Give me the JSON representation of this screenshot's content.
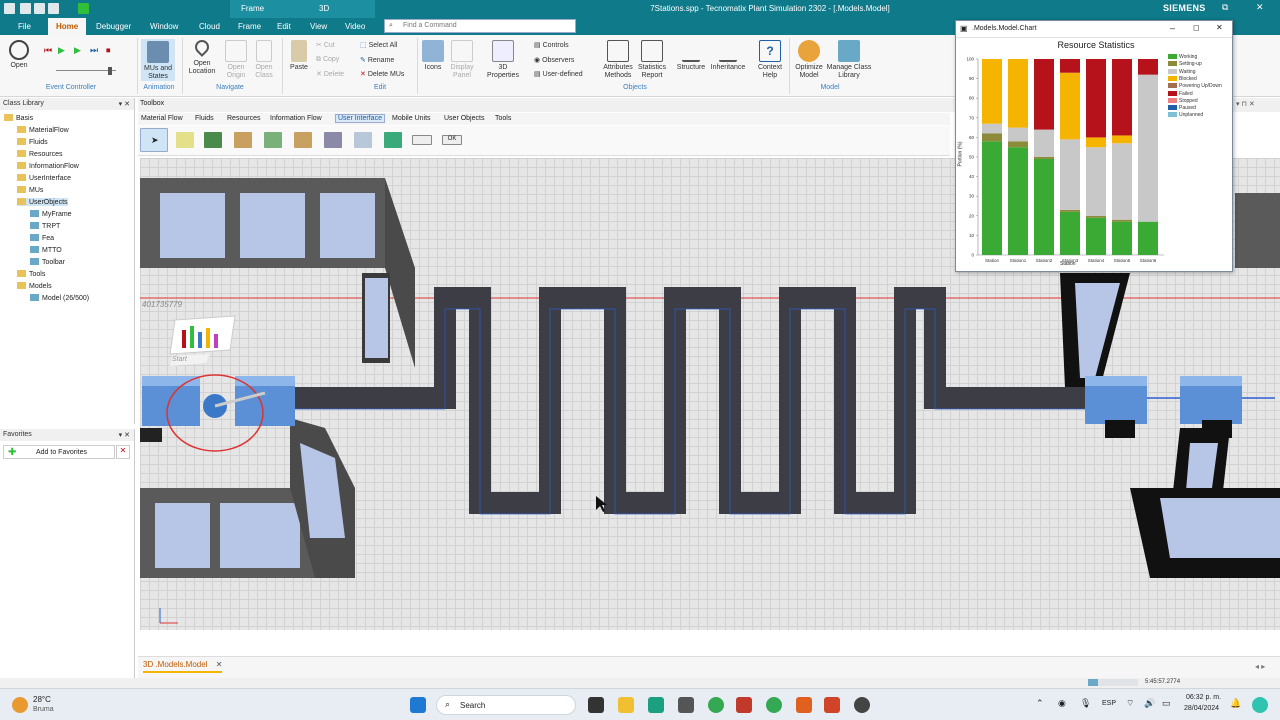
{
  "app": {
    "window_title": "7Stations.spp - Tecnomatix Plant Simulation 2302 - [.Models.Model]",
    "brand": "SIEMENS",
    "contextual_tabs": {
      "frame": "Frame",
      "threed": "3D"
    }
  },
  "menu": [
    "File",
    "Home",
    "Debugger",
    "Window",
    "Cloud",
    "Frame",
    "Edit",
    "View",
    "Video"
  ],
  "command_search": {
    "placeholder": "Find a Command"
  },
  "ribbon": {
    "event_controller": {
      "open": "Open",
      "group": "Event Controller"
    },
    "animation": {
      "mus_and_states": "MUs and States",
      "group": "Animation"
    },
    "navigate": {
      "open_location": "Open Location",
      "open_origin": "Open Origin",
      "open_class": "Open Class",
      "group": "Navigate"
    },
    "edit": {
      "paste": "Paste",
      "cut": "Cut",
      "copy": "Copy",
      "delete": "Delete",
      "select_all": "Select All",
      "rename": "Rename",
      "delete_mus": "Delete MUs",
      "group": "Edit"
    },
    "objects": {
      "icons": "Icons",
      "display_panel": "Display Panel",
      "properties_3d": "3D Properties",
      "controls": "Controls",
      "observers": "Observers",
      "user_defined": "User-defined",
      "attributes_methods": "Attributes Methods",
      "statistics_report": "Statistics Report",
      "structure": "Structure",
      "inheritance": "Inheritance",
      "context_help": "Context Help",
      "group": "Objects"
    },
    "model": {
      "optimize_model": "Optimize Model",
      "manage_class_library": "Manage Class Library",
      "group": "Model"
    }
  },
  "class_library": {
    "title": "Class Library",
    "items": [
      {
        "label": "Basis",
        "level": 0
      },
      {
        "label": "MaterialFlow",
        "level": 1
      },
      {
        "label": "Fluids",
        "level": 1
      },
      {
        "label": "Resources",
        "level": 1
      },
      {
        "label": "InformationFlow",
        "level": 1
      },
      {
        "label": "UserInterface",
        "level": 1
      },
      {
        "label": "MUs",
        "level": 1
      },
      {
        "label": "UserObjects",
        "level": 1
      },
      {
        "label": "MyFrame",
        "level": 2
      },
      {
        "label": "TRPT",
        "level": 2
      },
      {
        "label": "Fea",
        "level": 2
      },
      {
        "label": "MTTO",
        "level": 2
      },
      {
        "label": "Toolbar",
        "level": 2
      },
      {
        "label": "Tools",
        "level": 1
      },
      {
        "label": "Models",
        "level": 1
      },
      {
        "label": "Model (26/500)",
        "level": 2
      }
    ]
  },
  "favorites": {
    "title": "Favorites",
    "add_label": "Add to Favorites"
  },
  "toolbox": {
    "title": "Toolbox",
    "tabs": [
      "Material Flow",
      "Fluids",
      "Resources",
      "Information Flow",
      "User Interface",
      "Mobile Units",
      "User Objects",
      "Tools"
    ],
    "active_tab": "User Interface",
    "ok_label": "OK"
  },
  "scene": {
    "id_label": "401735779",
    "start_label": "Start"
  },
  "document_tab": {
    "label": "3D .Models.Model"
  },
  "status": {
    "time": "5:45:57.2774"
  },
  "chart_window": {
    "title": ".Models.Model.Chart"
  },
  "chart_data": {
    "type": "bar",
    "stacked": true,
    "title": "Resource Statistics",
    "ylabel": "Portion (%)",
    "xlabel": "Station",
    "ylim": [
      0,
      100
    ],
    "yticks": [
      0,
      10,
      20,
      30,
      40,
      50,
      60,
      70,
      80,
      90,
      100
    ],
    "grid": false,
    "legend_position": "right",
    "categories": [
      "Station",
      "Station1",
      "Station2",
      "Station3",
      "Station4",
      "Station5",
      "Station6"
    ],
    "series": [
      {
        "name": "Working",
        "color": "#3aaa35",
        "values": [
          58,
          55,
          49,
          22,
          19,
          17,
          17
        ]
      },
      {
        "name": "Setting-up",
        "color": "#8b8b3a",
        "values": [
          4,
          3,
          1,
          1,
          1,
          1,
          0
        ]
      },
      {
        "name": "Waiting",
        "color": "#c8c8c8",
        "values": [
          5,
          7,
          14,
          36,
          35,
          39,
          75
        ]
      },
      {
        "name": "Blocked",
        "color": "#f5b400",
        "values": [
          33,
          35,
          0,
          34,
          5,
          4,
          0
        ]
      },
      {
        "name": "Powering Up/Down",
        "color": "#a07050",
        "values": [
          0,
          0,
          0,
          0,
          0,
          0,
          0
        ]
      },
      {
        "name": "Failed",
        "color": "#b5121b",
        "values": [
          0,
          0,
          36,
          7,
          40,
          39,
          8
        ]
      },
      {
        "name": "Stopped",
        "color": "#f08080",
        "values": [
          0,
          0,
          0,
          0,
          0,
          0,
          0
        ]
      },
      {
        "name": "Paused",
        "color": "#1f5fa8",
        "values": [
          0,
          0,
          0,
          0,
          0,
          0,
          0
        ]
      },
      {
        "name": "Unplanned",
        "color": "#7ec0d6",
        "values": [
          0,
          0,
          0,
          0,
          0,
          0,
          0
        ]
      }
    ]
  },
  "taskbar": {
    "weather": {
      "temp": "28°C",
      "condition": "Bruma"
    },
    "search": "Search",
    "lang": "ESP",
    "clock": {
      "time": "06:32 p. m.",
      "date": "28/04/2024"
    }
  }
}
